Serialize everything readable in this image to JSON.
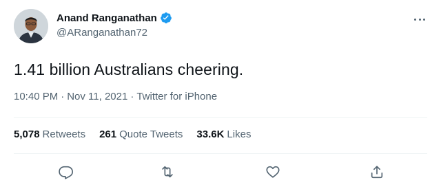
{
  "author": {
    "name": "Anand Ranganathan",
    "handle": "@ARanganathan72",
    "verified": true
  },
  "tweet": {
    "text": "1.41 billion Australians cheering.",
    "time": "10:40 PM",
    "date": "Nov 11, 2021",
    "source": "Twitter for iPhone",
    "separator": "·"
  },
  "stats": [
    {
      "count": "5,078",
      "label": "Retweets"
    },
    {
      "count": "261",
      "label": "Quote Tweets"
    },
    {
      "count": "33.6K",
      "label": "Likes"
    }
  ],
  "actions": [
    {
      "name": "reply-icon"
    },
    {
      "name": "retweet-icon"
    },
    {
      "name": "like-icon"
    },
    {
      "name": "share-icon"
    }
  ],
  "colors": {
    "text": "#0f1419",
    "secondary": "#536471",
    "verified": "#1d9bf0",
    "divider": "#eff3f4"
  }
}
